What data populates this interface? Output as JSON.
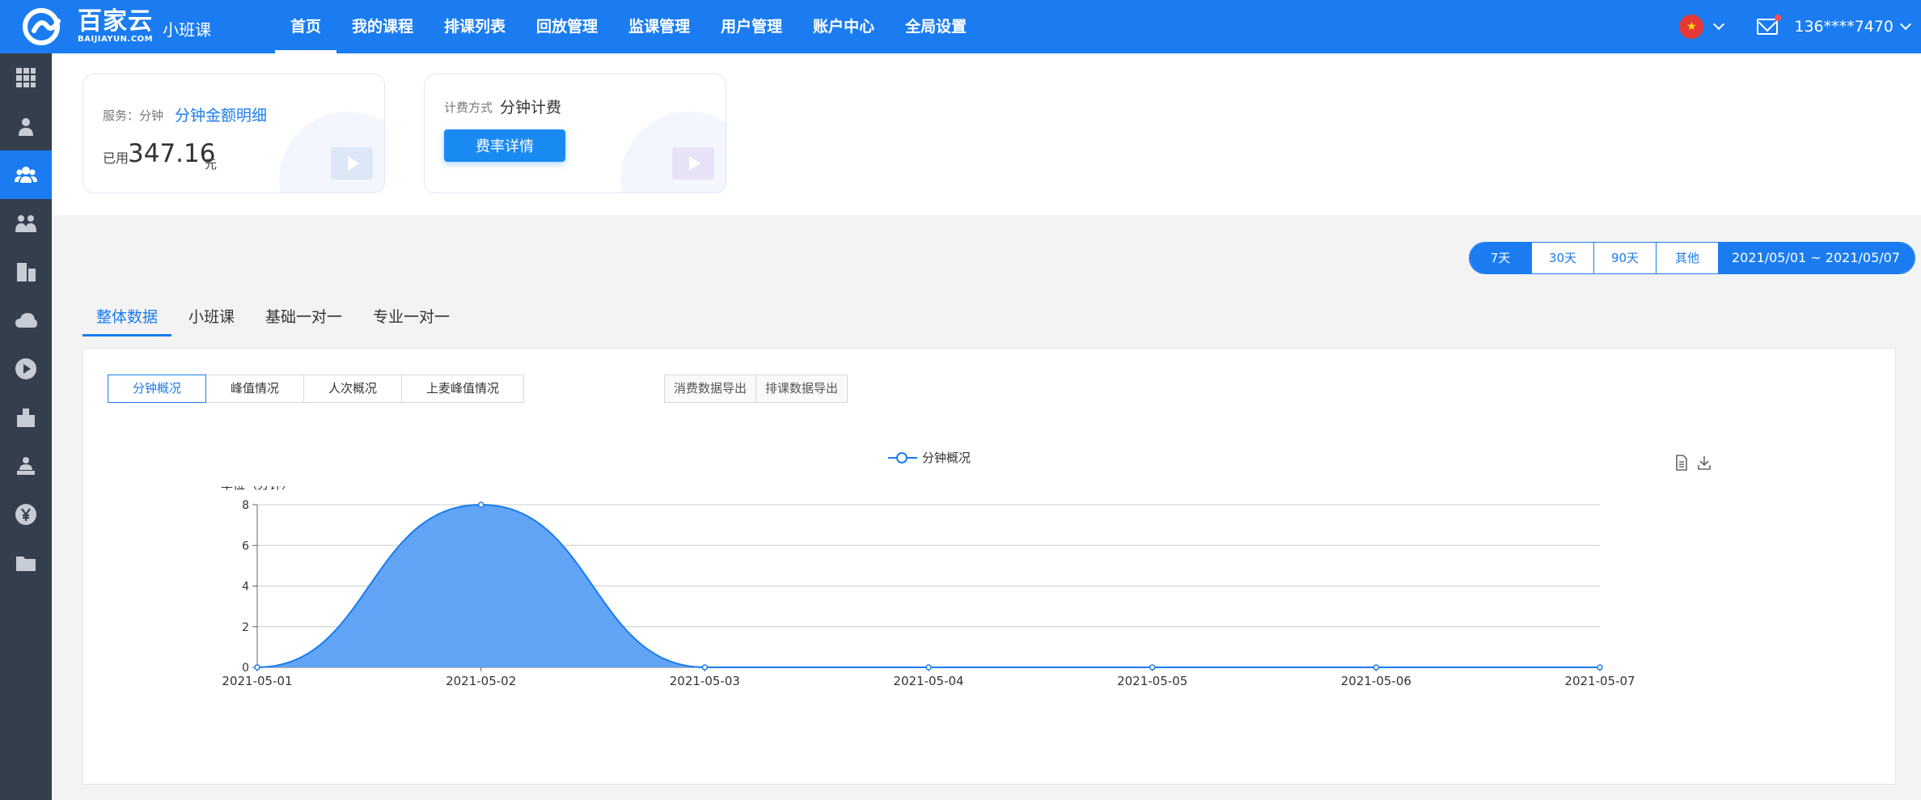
{
  "brand": {
    "name": "百家云",
    "domain": "BAIJIAYUN.COM",
    "product": "小班课"
  },
  "nav": [
    {
      "label": "首页",
      "active": true
    },
    {
      "label": "我的课程"
    },
    {
      "label": "排课列表"
    },
    {
      "label": "回放管理"
    },
    {
      "label": "监课管理"
    },
    {
      "label": "用户管理"
    },
    {
      "label": "账户中心"
    },
    {
      "label": "全局设置"
    }
  ],
  "user": {
    "account": "136****7470"
  },
  "sidebar": [
    {
      "icon": "grid-icon"
    },
    {
      "icon": "user-icon"
    },
    {
      "icon": "users-group-icon",
      "active": true
    },
    {
      "icon": "class-icon"
    },
    {
      "icon": "building-icon"
    },
    {
      "icon": "cloud-icon"
    },
    {
      "icon": "play-icon"
    },
    {
      "icon": "institution-icon"
    },
    {
      "icon": "teacher-icon"
    },
    {
      "icon": "yen-icon"
    },
    {
      "icon": "folder-icon"
    }
  ],
  "service_card": {
    "service_label": "服务：分钟",
    "detail_link": "分钟金额明细",
    "used_label": "已用",
    "amount": "347.16",
    "unit": "元"
  },
  "billing_card": {
    "label": "计费方式",
    "value": "分钟计费",
    "button": "费率详情"
  },
  "date_range": {
    "options": [
      {
        "label": "7天",
        "active": true
      },
      {
        "label": "30天"
      },
      {
        "label": "90天"
      },
      {
        "label": "其他"
      }
    ],
    "range": "2021/05/01  ~  2021/05/07"
  },
  "tabs": [
    {
      "label": "整体数据",
      "active": true
    },
    {
      "label": "小班课"
    },
    {
      "label": "基础一对一"
    },
    {
      "label": "专业一对一"
    }
  ],
  "segments": [
    {
      "label": "分钟概况",
      "active": true
    },
    {
      "label": "峰值情况"
    },
    {
      "label": "人次概况"
    },
    {
      "label": "上麦峰值情况"
    }
  ],
  "exports": [
    "消费数据导出",
    "排课数据导出"
  ],
  "chart_data": {
    "type": "area",
    "ylabel": "单位（分钟）",
    "x": [
      "2021-05-01",
      "2021-05-02",
      "2021-05-03",
      "2021-05-04",
      "2021-05-05",
      "2021-05-06",
      "2021-05-07"
    ],
    "series": [
      {
        "name": "分钟概况",
        "values": [
          0,
          8,
          0,
          0,
          0,
          0,
          0
        ]
      }
    ],
    "yticks": [
      0,
      2,
      4,
      6,
      8
    ],
    "ylim": [
      0,
      8
    ],
    "grid": true,
    "legend": "top-center",
    "color": "#1a7cf0",
    "fill": "#5aa0f6"
  }
}
